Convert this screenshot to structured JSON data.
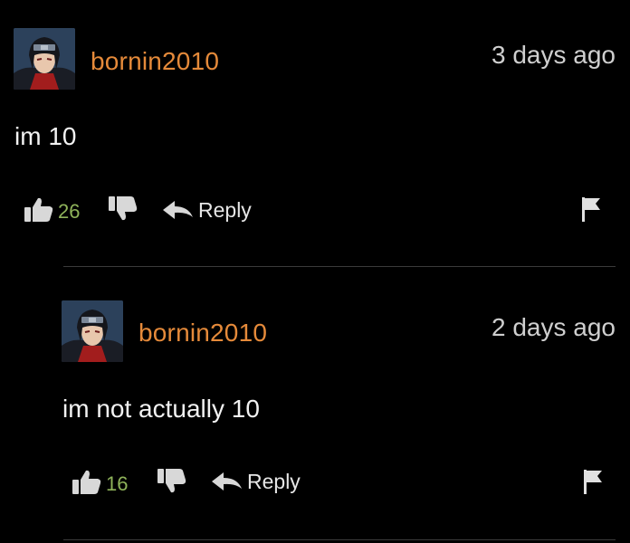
{
  "comments": [
    {
      "username": "bornin2010",
      "time_ago": "3 days ago",
      "text": "im 10",
      "likes": "26",
      "reply_label": "Reply"
    },
    {
      "username": "bornin2010",
      "time_ago": "2 days ago",
      "text": "im not actually 10",
      "likes": "16",
      "reply_label": "Reply"
    }
  ],
  "colors": {
    "background": "#000000",
    "username": "#e58a3a",
    "likes": "#8fb35a",
    "text": "#f2f2f2",
    "muted": "#cfcfcf",
    "divider": "#3a3a3a"
  },
  "icons": [
    "avatar",
    "thumbs-up-icon",
    "thumbs-down-icon",
    "reply-arrow-icon",
    "flag-icon"
  ]
}
